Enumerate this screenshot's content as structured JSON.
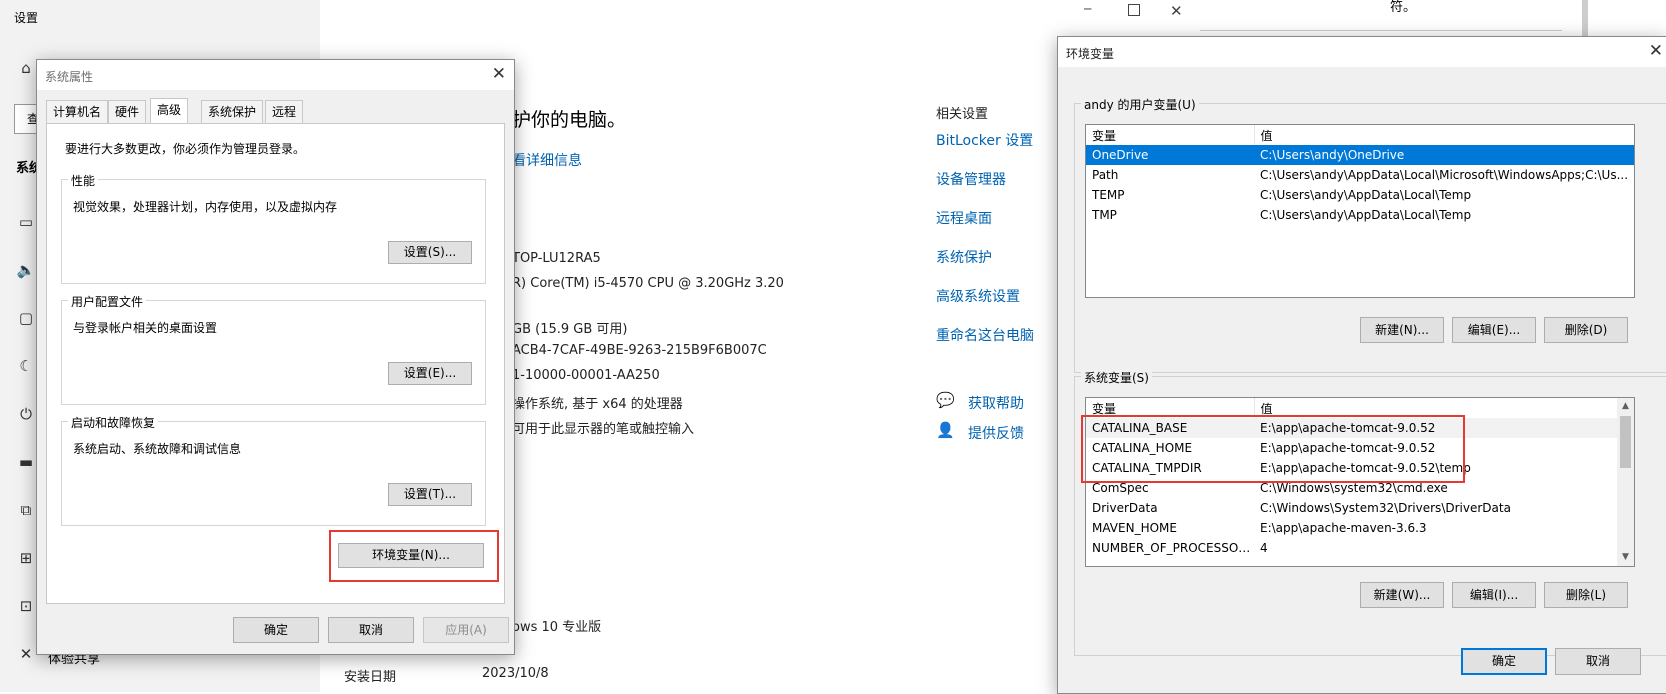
{
  "settings": {
    "window_title": "设置",
    "left_nav_partial": [
      "查",
      "系统",
      "体验共享"
    ],
    "main_heading_partial": "护你的电脑。",
    "detail_link_partial": "看详细信息",
    "specs": [
      "TOP-LU12RA5",
      "R) Core(TM) i5-4570 CPU @ 3.20GHz   3.20",
      "GB (15.9 GB 可用)",
      "ACB4-7CAF-49BE-9263-215B9F6B007C",
      "1-10000-00001-AA250",
      "操作系统, 基于 x64 的处理器",
      "可用于此显示器的笔或触控输入"
    ],
    "edition_partial": "ows 10 专业版",
    "install_date_label": "安装日期",
    "install_date_value": "2023/10/8",
    "related_title": "相关设置",
    "related_links": [
      "BitLocker 设置",
      "设备管理器",
      "远程桌面",
      "系统保护",
      "高级系统设置",
      "重命名这台电脑"
    ],
    "help_link": "获取帮助",
    "feedback_link": "提供反馈",
    "top_partial_text": "符。"
  },
  "sysprops": {
    "title": "系统属性",
    "tabs": [
      "计算机名",
      "硬件",
      "高级",
      "系统保护",
      "远程"
    ],
    "admin_note": "要进行大多数更改，你必须作为管理员登录。",
    "groups": [
      {
        "label": "性能",
        "desc": "视觉效果，处理器计划，内存使用，以及虚拟内存",
        "button": "设置(S)..."
      },
      {
        "label": "用户配置文件",
        "desc": "与登录帐户相关的桌面设置",
        "button": "设置(E)..."
      },
      {
        "label": "启动和故障恢复",
        "desc": "系统启动、系统故障和调试信息",
        "button": "设置(T)..."
      }
    ],
    "env_button": "环境变量(N)...",
    "ok": "确定",
    "cancel": "取消",
    "apply": "应用(A)"
  },
  "envvars": {
    "title": "环境变量",
    "user_group": "andy 的用户变量(U)",
    "col_var": "变量",
    "col_val": "值",
    "user_vars": [
      {
        "name": "OneDrive",
        "value": "C:\\Users\\andy\\OneDrive"
      },
      {
        "name": "Path",
        "value": "C:\\Users\\andy\\AppData\\Local\\Microsoft\\WindowsApps;C:\\Us..."
      },
      {
        "name": "TEMP",
        "value": "C:\\Users\\andy\\AppData\\Local\\Temp"
      },
      {
        "name": "TMP",
        "value": "C:\\Users\\andy\\AppData\\Local\\Temp"
      }
    ],
    "user_buttons": [
      "新建(N)...",
      "编辑(E)...",
      "删除(D)"
    ],
    "system_group": "系统变量(S)",
    "system_vars": [
      {
        "name": "CATALINA_BASE",
        "value": "E:\\app\\apache-tomcat-9.0.52"
      },
      {
        "name": "CATALINA_HOME",
        "value": "E:\\app\\apache-tomcat-9.0.52"
      },
      {
        "name": "CATALINA_TMPDIR",
        "value": "E:\\app\\apache-tomcat-9.0.52\\temp"
      },
      {
        "name": "ComSpec",
        "value": "C:\\Windows\\system32\\cmd.exe"
      },
      {
        "name": "DriverData",
        "value": "C:\\Windows\\System32\\Drivers\\DriverData"
      },
      {
        "name": "MAVEN_HOME",
        "value": "E:\\app\\apache-maven-3.6.3"
      },
      {
        "name": "NUMBER_OF_PROCESSORS",
        "value": "4"
      }
    ],
    "system_buttons": [
      "新建(W)...",
      "编辑(I)...",
      "删除(L)"
    ],
    "ok": "确定",
    "cancel": "取消"
  },
  "colors": {
    "accent": "#0078d7",
    "link": "#0063b1",
    "highlight_box": "#e53935"
  }
}
